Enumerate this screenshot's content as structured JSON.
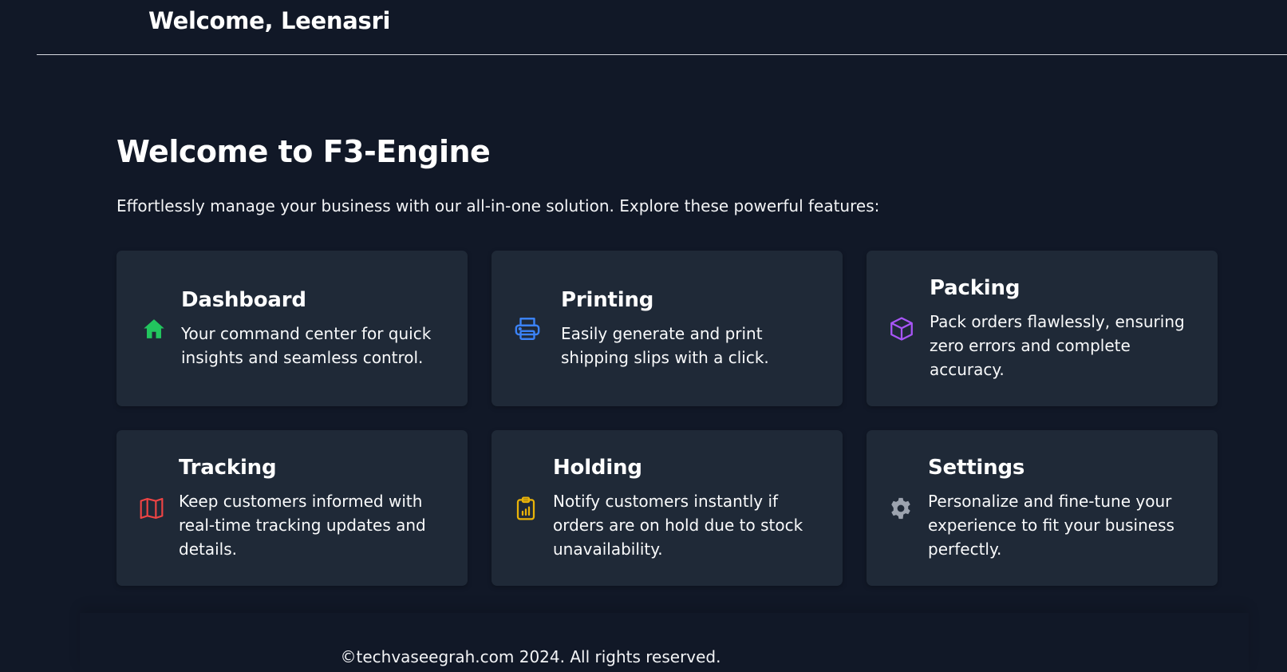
{
  "header": {
    "greeting": "Welcome, Leenasri"
  },
  "main": {
    "title": "Welcome to F3-Engine",
    "intro": "Effortlessly manage your business with our all-in-one solution. Explore these powerful features:"
  },
  "features": [
    {
      "title": "Dashboard",
      "description": "Your command center for quick insights and seamless control.",
      "icon": "home-icon",
      "color": "#22c55e"
    },
    {
      "title": "Printing",
      "description": "Easily generate and print shipping slips with a click.",
      "icon": "printer-icon",
      "color": "#3b82f6"
    },
    {
      "title": "Packing",
      "description": "Pack orders flawlessly, ensuring zero errors and complete accuracy.",
      "icon": "box-icon",
      "color": "#a855f7"
    },
    {
      "title": "Tracking",
      "description": "Keep customers informed with real-time tracking updates and details.",
      "icon": "map-icon",
      "color": "#ef4444"
    },
    {
      "title": "Holding",
      "description": "Notify customers instantly if orders are on hold due to stock unavailability.",
      "icon": "clipboard-chart-icon",
      "color": "#eab308"
    },
    {
      "title": "Settings",
      "description": "Personalize and fine-tune your experience to fit your business perfectly.",
      "icon": "gear-icon",
      "color": "#9ca3af"
    }
  ],
  "footer": {
    "copyright": "©techvaseegrah.com 2024. All rights reserved."
  },
  "colors": {
    "background": "#111827",
    "card": "#1f2937",
    "text": "#ffffff"
  }
}
